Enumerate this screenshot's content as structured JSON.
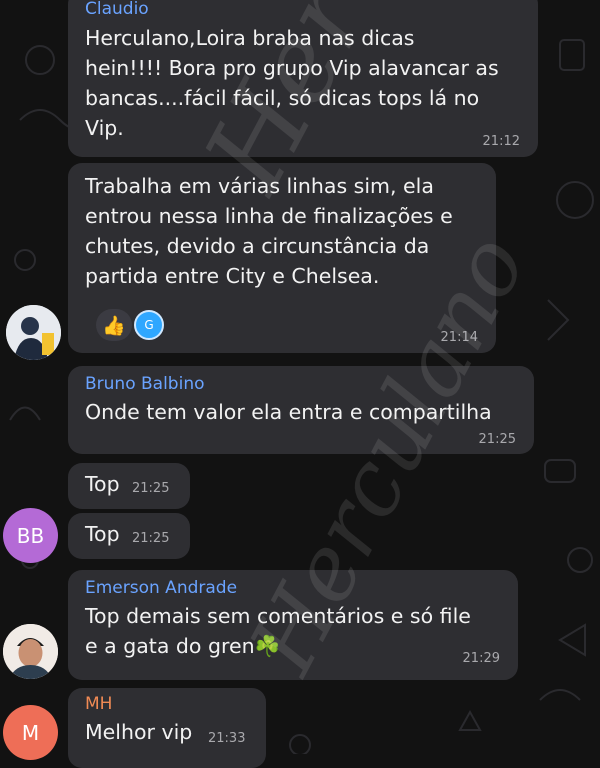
{
  "colors": {
    "background": "#121212",
    "bubble": "#2e2e32",
    "sender_blue": "#6aa3ff",
    "sender_orange": "#f08a54",
    "avatar_purple": "#b46ad6",
    "avatar_red": "#ee6e57",
    "reaction_blue": "#2fa7ff"
  },
  "watermark": "Herculano",
  "messages": [
    {
      "sender": "Claudio",
      "text": "Herculano,Loira braba nas dicas\nhein!!!! Bora pro grupo Vip alavancar as\nbancas....fácil fácil, só dicas tops lá no\nVip.",
      "time": "21:12"
    },
    {
      "text": "Trabalha em várias linhas sim, ela\nentrou nessa linha de finalizações e\nchutes, devido a circunstância da\npartida entre City e Chelsea.",
      "time": "21:14",
      "reactions": [
        {
          "icon": "thumbs-up-icon",
          "glyph": "👍"
        },
        {
          "icon": "reactor-avatar-g",
          "initial": "G"
        }
      ]
    },
    {
      "sender": "Bruno Balbino",
      "text": "Onde tem valor ela entra e compartilha",
      "time": "21:25"
    },
    {
      "text": "Top",
      "time": "21:25"
    },
    {
      "text": "Top",
      "time": "21:25",
      "avatar_initials": "BB"
    },
    {
      "sender": "Emerson Andrade",
      "text": "Top demais sem comentários e só file\ne a gata do gren",
      "emoji": "☘️",
      "time": "21:29"
    },
    {
      "sender": "MH",
      "text": "Melhor vip",
      "time": "21:33",
      "avatar_initials": "M"
    }
  ]
}
